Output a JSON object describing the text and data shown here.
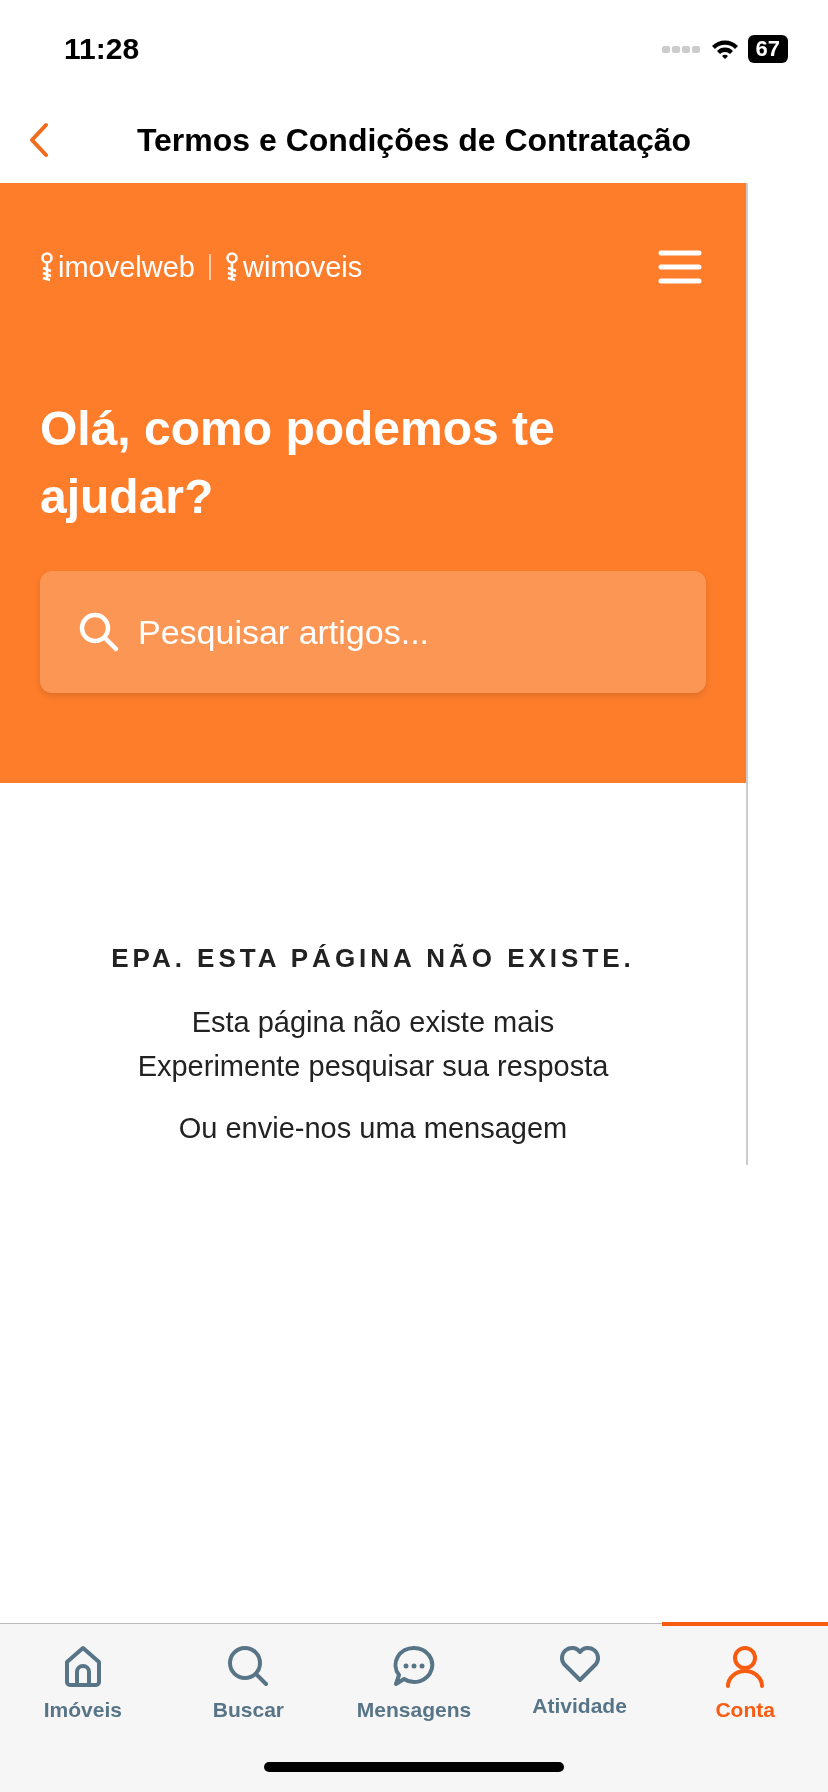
{
  "status_bar": {
    "time": "11:28",
    "battery": "67"
  },
  "nav": {
    "title": "Termos e Condições de Contratação"
  },
  "header": {
    "brands": [
      "imovelweb",
      "wimoveis"
    ],
    "heading": "Olá, como podemos te ajudar?",
    "search": {
      "placeholder": "Pesquisar artigos..."
    }
  },
  "error": {
    "title": "EPA. ESTA PÁGINA NÃO EXISTE.",
    "lines": [
      "Esta página não existe mais",
      "Experimente pesquisar sua resposta"
    ],
    "link": "Ou envie-nos uma mensagem"
  },
  "tabs": [
    {
      "kind": "home",
      "label": "Imóveis",
      "selected": false
    },
    {
      "kind": "search",
      "label": "Buscar",
      "selected": false
    },
    {
      "kind": "chat",
      "label": "Mensagens",
      "selected": false
    },
    {
      "kind": "heart",
      "label": "Atividade",
      "selected": false
    },
    {
      "kind": "person",
      "label": "Conta",
      "selected": true
    }
  ]
}
